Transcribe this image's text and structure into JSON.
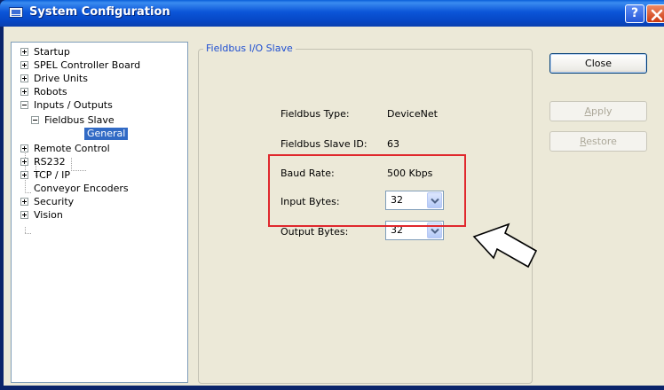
{
  "window": {
    "title": "System Configuration",
    "help_label": "?"
  },
  "tree": {
    "items": [
      {
        "label": "Startup",
        "expander": "plus"
      },
      {
        "label": "SPEL Controller Board",
        "expander": "plus"
      },
      {
        "label": "Drive Units",
        "expander": "plus"
      },
      {
        "label": "Robots",
        "expander": "plus"
      },
      {
        "label": "Inputs / Outputs",
        "expander": "minus"
      },
      {
        "label": "Fieldbus Slave",
        "expander": "minus"
      },
      {
        "label": "General",
        "selected": true
      },
      {
        "label": "Remote Control",
        "expander": "plus"
      },
      {
        "label": "RS232",
        "expander": "plus"
      },
      {
        "label": "TCP / IP",
        "expander": "plus"
      },
      {
        "label": "Conveyor Encoders"
      },
      {
        "label": "Security",
        "expander": "plus"
      },
      {
        "label": "Vision",
        "expander": "plus"
      }
    ]
  },
  "panel": {
    "group_title": "Fieldbus I/O Slave",
    "fieldbus_type_label": "Fieldbus Type:",
    "fieldbus_type_value": "DeviceNet",
    "slave_id_label": "Fieldbus Slave ID:",
    "slave_id_value": "63",
    "baud_rate_label": "Baud Rate:",
    "baud_rate_value": "500 Kbps",
    "input_bytes_label": "Input Bytes:",
    "input_bytes_value": "32",
    "output_bytes_label": "Output Bytes:",
    "output_bytes_value": "32"
  },
  "buttons": {
    "close": "Close",
    "apply_first": "A",
    "apply_rest": "pply",
    "restore_first": "R",
    "restore_rest": "estore"
  },
  "colors": {
    "title_bar": "#0a55d8",
    "selection": "#316ac5",
    "group_title": "#1f4fd1",
    "highlight": "#e0282d"
  },
  "icons": {
    "app": "app-window-icon",
    "help": "help-icon",
    "close": "close-icon",
    "dropdown": "chevron-down-icon",
    "callout": "pointer-arrow-icon"
  }
}
